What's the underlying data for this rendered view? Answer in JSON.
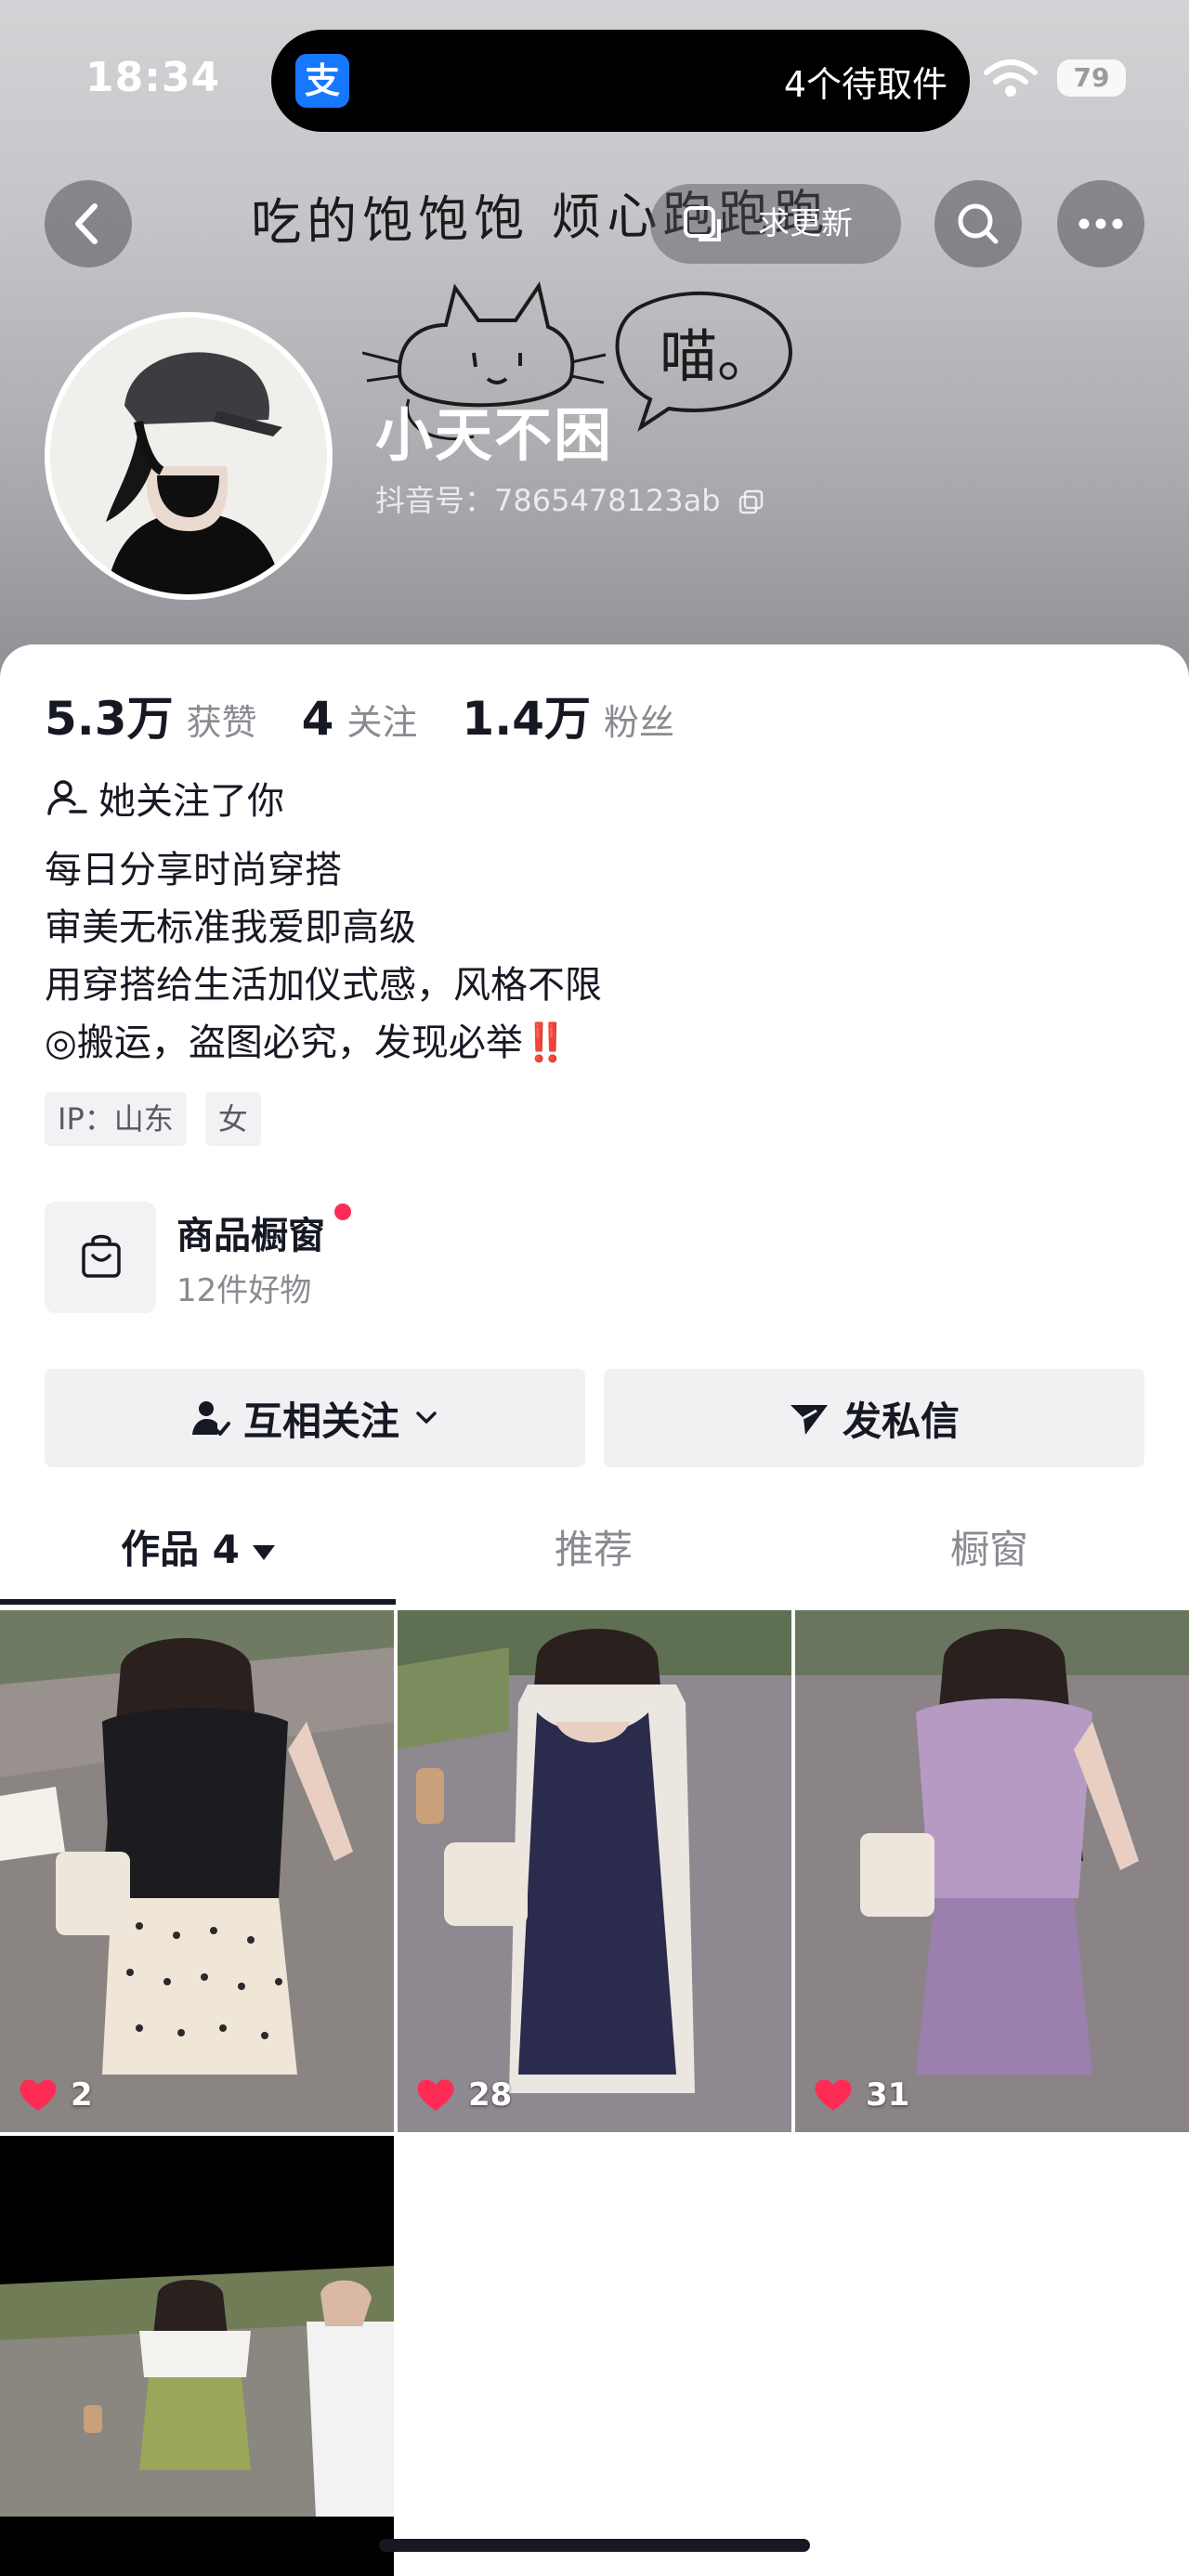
{
  "status_bar": {
    "time": "18:34",
    "notification_icon": "alipay-icon",
    "notification_icon_glyph": "支",
    "notification_text": "4个待取件",
    "battery": "79"
  },
  "header": {
    "banner_text": "吃的饱饱饱  烦心跑跑跑",
    "banner_meow": "喵。",
    "update_label": "求更新"
  },
  "profile": {
    "username": "小天不困",
    "douyin_id": "抖音号：7865478123ab",
    "stats": [
      {
        "value": "5.3万",
        "label": "获赞"
      },
      {
        "value": "4",
        "label": "关注"
      },
      {
        "value": "1.4万",
        "label": "粉丝"
      }
    ],
    "follows_you": "她关注了你",
    "bio": [
      "每日分享时尚穿搭",
      "审美无标准我爱即高级",
      "用穿搭给生活加仪式感，风格不限",
      "◎搬运，盗图必究，发现必举"
    ],
    "bio_emoji": "‼️",
    "tags": [
      "IP：山东",
      "女"
    ]
  },
  "shop": {
    "title": "商品橱窗",
    "subtitle": "12件好物"
  },
  "actions": {
    "mutual_follow": "互相关注",
    "send_message": "发私信"
  },
  "tabs": [
    {
      "label": "作品 4"
    },
    {
      "label": "推荐"
    },
    {
      "label": "橱窗"
    }
  ],
  "posts": [
    {
      "likes": "2",
      "outfit_color": "#1c1b1f"
    },
    {
      "likes": "28",
      "outfit_color": "#2a2b4d"
    },
    {
      "likes": "31",
      "outfit_color": "#b69ac4"
    },
    {
      "likes": "",
      "outfit_color": "#9aa65a"
    }
  ],
  "colors": {
    "accent": "#fe2c55",
    "text_primary": "#161823",
    "text_secondary": "#8a8b91",
    "button_bg": "#f1f1f3"
  }
}
